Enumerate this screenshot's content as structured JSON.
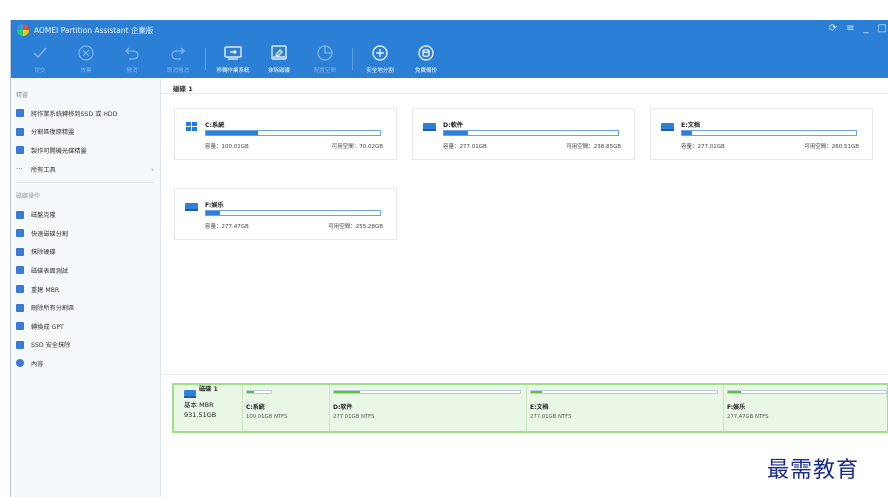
{
  "app": {
    "title": "AOMEI Partition Assistant 企業版",
    "win_controls": [
      "⟳",
      "≡",
      "_",
      "□"
    ]
  },
  "toolbar": [
    {
      "label": "提交",
      "icon": "check-icon",
      "enabled": false
    },
    {
      "label": "放棄",
      "icon": "discard-icon",
      "enabled": false
    },
    {
      "label": "撤消",
      "icon": "undo-icon",
      "enabled": false
    },
    {
      "label": "取消撤消",
      "icon": "redo-icon",
      "enabled": false
    },
    {
      "label": "移轉作業系統",
      "icon": "migrate-os-icon",
      "enabled": true
    },
    {
      "label": "抹除磁碟",
      "icon": "wipe-disk-icon",
      "enabled": true
    },
    {
      "label": "配置空間",
      "icon": "allocate-space-icon",
      "enabled": false
    },
    {
      "label": "安全地分割",
      "icon": "shield-icon",
      "enabled": true
    },
    {
      "label": "免費備份",
      "icon": "backup-icon",
      "enabled": true
    }
  ],
  "sidebar": {
    "wizards_heading": "精靈",
    "wizards": [
      {
        "label": "將作業系統轉移到SSD 或 HDD",
        "icon": "migrate-icon",
        "color": "#3a7bd5"
      },
      {
        "label": "分割區復原精靈",
        "icon": "recovery-icon",
        "color": "#3a7bd5"
      },
      {
        "label": "製作可開機光碟精靈",
        "icon": "bootable-cd-icon",
        "color": "#3a7bd5"
      },
      {
        "label": "所有工具",
        "icon": "more-icon",
        "color": "#555555",
        "arrow": "›"
      }
    ],
    "disk_ops_heading": "磁碟操作",
    "disk_ops": [
      {
        "label": "磁盤克隆",
        "icon": "clone-icon",
        "color": "#3a7bd5"
      },
      {
        "label": "快速磁碟分割",
        "icon": "lightning-icon",
        "color": "#3a7bd5"
      },
      {
        "label": "抹除硬碟",
        "icon": "wipe-icon",
        "color": "#3a7bd5"
      },
      {
        "label": "磁碟表面測試",
        "icon": "surface-test-icon",
        "color": "#3a7bd5"
      },
      {
        "label": "重建 MBR",
        "icon": "rebuild-mbr-icon",
        "color": "#3a7bd5"
      },
      {
        "label": "刪除所有分割區",
        "icon": "delete-all-icon",
        "color": "#3a7bd5"
      },
      {
        "label": "轉換成 GPT",
        "icon": "convert-gpt-icon",
        "color": "#3a7bd5"
      },
      {
        "label": "SSD 安全抹除",
        "icon": "ssd-erase-icon",
        "color": "#3a7bd5"
      },
      {
        "label": "內容",
        "icon": "info-icon",
        "color": "#3a7bd5"
      }
    ]
  },
  "main": {
    "disk_header": "磁碟 1",
    "partitions": [
      {
        "name": "C:系統",
        "capacity": "容量：100.01GB",
        "free": "可用空間：70.02GB",
        "used_fraction": 0.3,
        "icon": "windows-drive-icon"
      },
      {
        "name": "D:軟件",
        "capacity": "容量：277.01GB",
        "free": "可用空間：238.85GB",
        "used_fraction": 0.14,
        "icon": "drive-icon"
      },
      {
        "name": "E:文档",
        "capacity": "容量：277.01GB",
        "free": "可用空間：260.51GB",
        "used_fraction": 0.06,
        "icon": "drive-icon"
      },
      {
        "name": "F:娱乐",
        "capacity": "容量：277.47GB",
        "free": "可用空間：255.28GB",
        "used_fraction": 0.08,
        "icon": "drive-icon"
      }
    ],
    "disk_map": {
      "name": "磁碟 1",
      "type": "基本 MBR",
      "size": "931.51GB",
      "parts": [
        {
          "name": "C:系統",
          "info": "100.01GB NTFS",
          "used_fraction": 0.3
        },
        {
          "name": "D:软件",
          "info": "277.01GB NTFS",
          "used_fraction": 0.14
        },
        {
          "name": "E:文档",
          "info": "277.01GB NTFS",
          "used_fraction": 0.06
        },
        {
          "name": "F:娱乐",
          "info": "277.47GB NTFS",
          "used_fraction": 0.08
        }
      ]
    }
  },
  "watermark": "最需教育"
}
